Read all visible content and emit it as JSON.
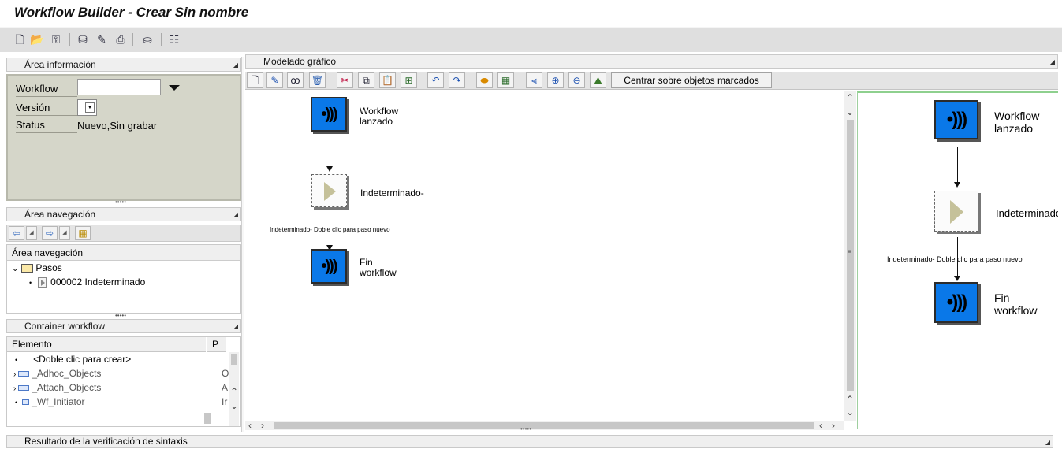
{
  "window": {
    "title": "Workflow Builder - Crear Sin nombre"
  },
  "toolbar": {
    "icons": [
      "new-document-icon",
      "open-folder-icon",
      "key-wand-icon",
      "hierarchy-icon",
      "pencil-icon",
      "print-icon",
      "hat-icon",
      "list-icon"
    ]
  },
  "info_area": {
    "header": "Área información",
    "workflow_label": "Workflow",
    "workflow_value": "",
    "version_label": "Versión",
    "version_value": "",
    "status_label": "Status",
    "status_value": "Nuevo,Sin grabar"
  },
  "nav_area": {
    "header": "Área navegación",
    "tree_header": "Área navegación",
    "folder": "Pasos",
    "step_item": "000002 Indeterminado"
  },
  "container": {
    "header": "Container workflow",
    "col_element": "Elemento",
    "col_p": "P",
    "rows": [
      {
        "label": "<Doble clic para crear>",
        "p": ""
      },
      {
        "label": "_Adhoc_Objects",
        "p": "O"
      },
      {
        "label": "_Attach_Objects",
        "p": "A"
      },
      {
        "label": "_Wf_Initiator",
        "p": "Ir"
      }
    ]
  },
  "graphic": {
    "header": "Modelado gráfico",
    "center_button": "Centrar sobre objetos marcados",
    "node_start": "Workflow\nlanzado",
    "node_start_l1": "Workflow",
    "node_start_l2": "lanzado",
    "node_step": "Indeterminado-",
    "hint": "Indeterminado- Doble clic para paso nuevo",
    "node_end_l1": "Fin",
    "node_end_l2": "workflow"
  },
  "syntax": {
    "header": "Resultado de la verificación de sintaxis"
  },
  "colors": {
    "event_blue": "#0a78e8",
    "info_bg": "#d5d6c9",
    "overview_border": "#8ed08e"
  }
}
